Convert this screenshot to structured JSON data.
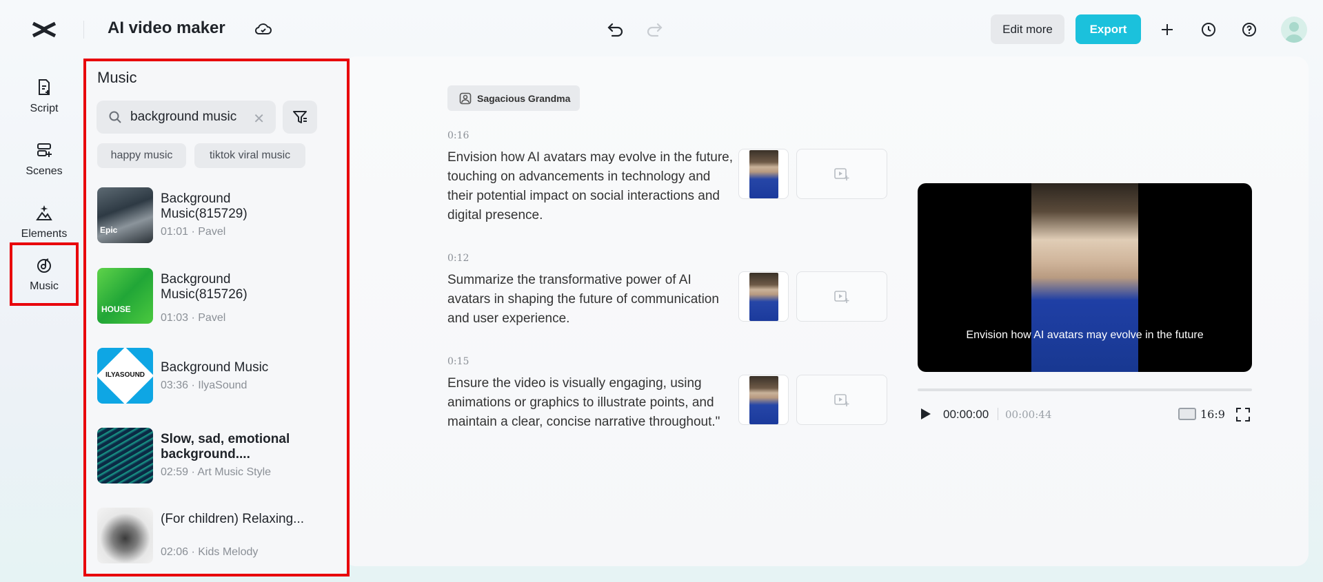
{
  "app": {
    "title": "AI video maker"
  },
  "toolbar": {
    "edit_more": "Edit more",
    "export": "Export"
  },
  "nav": [
    {
      "label": "Script",
      "icon": "script-icon"
    },
    {
      "label": "Scenes",
      "icon": "scenes-icon"
    },
    {
      "label": "Elements",
      "icon": "elements-icon"
    },
    {
      "label": "Music",
      "icon": "music-icon",
      "active": true
    }
  ],
  "music_panel": {
    "title": "Music",
    "search": {
      "value": "background music"
    },
    "chips": [
      "happy music",
      "tiktok viral music"
    ],
    "tracks": [
      {
        "title": "Background Music(815729)",
        "duration": "01:01",
        "artist": "Pavel",
        "meta": "01:01 · Pavel",
        "thumb_label": "Epic"
      },
      {
        "title": "Background Music(815726)",
        "duration": "01:03",
        "artist": "Pavel",
        "meta": "01:03 · Pavel",
        "thumb_label": "HOUSE"
      },
      {
        "title": "Background Music",
        "duration": "03:36",
        "artist": "IlyaSound",
        "meta": "03:36 · IlyaSound",
        "thumb_label": "ILYASOUND"
      },
      {
        "title": "Slow, sad, emotional background....",
        "duration": "02:59",
        "artist": "Art Music Style",
        "meta": "02:59 · Art Music Style",
        "thumb_label": ""
      },
      {
        "title": "(For children) Relaxing...",
        "duration": "02:06",
        "artist": "Kids Melody",
        "meta": "02:06 · Kids Melody",
        "thumb_label": ""
      }
    ]
  },
  "script": {
    "avatar_name": "Sagacious Grandma",
    "scenes": [
      {
        "time": "0:16",
        "text": "Envision how AI avatars may evolve in the future, touching on advancements in technology and their potential impact on social interactions and digital presence."
      },
      {
        "time": "0:12",
        "text": "Summarize the transformative power of AI avatars in shaping the future of communication and user experience."
      },
      {
        "time": "0:15",
        "text": "Ensure the video is visually engaging, using animations or graphics to illustrate points, and maintain a clear, concise narrative throughout.\""
      }
    ]
  },
  "preview": {
    "caption": "Envision how AI avatars may evolve in the future",
    "current_time": "00:00:00",
    "total_time": "00:00:44",
    "aspect_ratio": "16:9",
    "progress": 0
  },
  "colors": {
    "accent": "#1bc1dc",
    "highlight": "#e8000b"
  }
}
